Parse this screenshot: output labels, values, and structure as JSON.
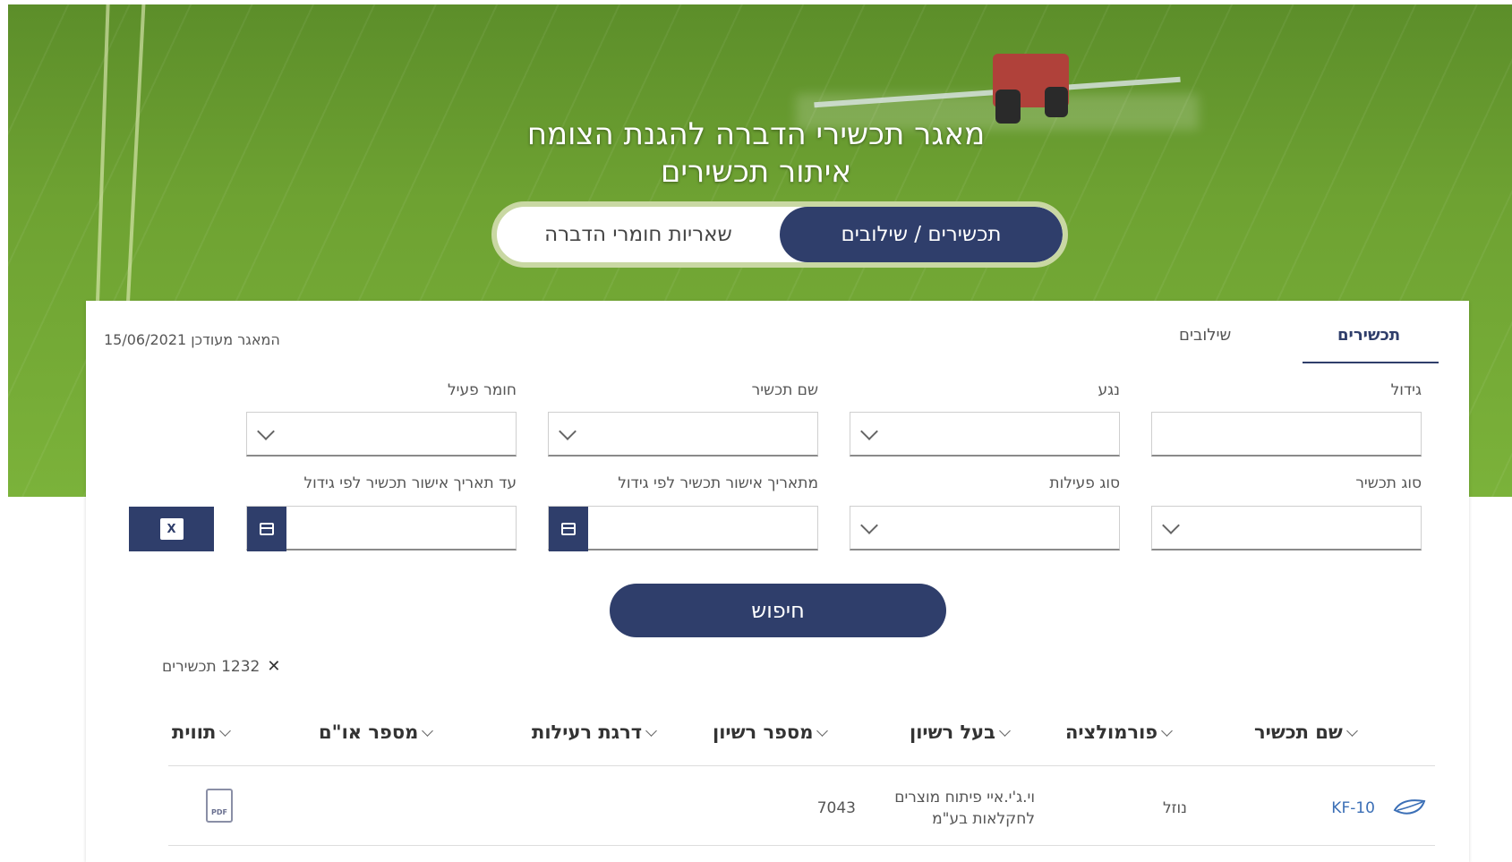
{
  "hero": {
    "title": "מאגר תכשירי הדברה להגנת הצומח",
    "subtitle": "איתור תכשירים",
    "toggle": {
      "active": "תכשירים / שילובים",
      "inactive": "שאריות חומרי הדברה"
    }
  },
  "panel": {
    "tabs": [
      "תכשירים",
      "שילובים"
    ],
    "updated_text": "המאגר מעודכן 15/06/2021",
    "filters": {
      "crop": "גידול",
      "pest": "נגע",
      "product_name": "שם תכשיר",
      "active_ingredient": "חומר פעיל",
      "product_type": "סוג תכשיר",
      "activity_type": "סוג פעילות",
      "from_date": "מתאריך אישור תכשיר לפי גידול",
      "to_date": "עד תאריך אישור תכשיר לפי גידול"
    },
    "excel_icon_text": "X",
    "search_label": "חיפוש",
    "result_count": "1232 תכשירים",
    "clear_symbol": "✕"
  },
  "table": {
    "headers": [
      "שם תכשיר",
      "פורמולציה",
      "בעל רשיון",
      "מספר רשיון",
      "דרגת רעילות",
      "מספר או\"ם",
      "תווית"
    ],
    "rows": [
      {
        "name": "KF-10",
        "formulation": "נוזל",
        "licensee_line1": "וי.ג'י.איי פיתוח מוצרים",
        "licensee_line2": "לחקלאות בע\"מ",
        "license_no": "7043",
        "pdf_text": "PDF"
      }
    ]
  },
  "colors": {
    "primary": "#2f3e6b",
    "link": "#3b6fb6",
    "toggle_border": "#c9d8a3"
  },
  "icons": [
    "chevron-down-icon",
    "calendar-icon",
    "excel-icon",
    "close-icon",
    "leaf-icon",
    "pdf-icon"
  ]
}
